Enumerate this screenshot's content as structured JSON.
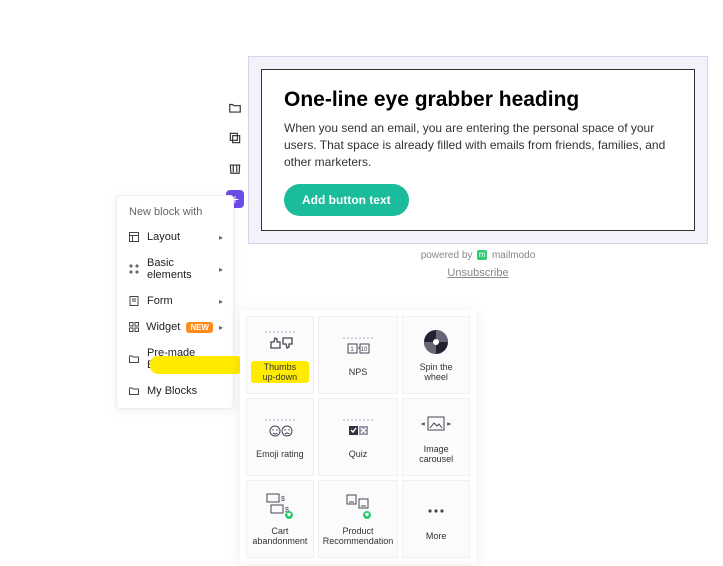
{
  "block": {
    "heading": "One-line eye grabber heading",
    "body": "When you send an email, you are entering the personal space of your users. That space is already filled with emails from friends, families, and other marketers.",
    "button": "Add button text"
  },
  "footer": {
    "powered_prefix": "powered by",
    "brand": "mailmodo",
    "unsubscribe": "Unsubscribe"
  },
  "menu": {
    "title": "New block with",
    "items": [
      {
        "label": "Layout",
        "has_sub": true
      },
      {
        "label": "Basic elements",
        "has_sub": true
      },
      {
        "label": "Form",
        "has_sub": true
      },
      {
        "label": "Widget",
        "badge": "NEW",
        "has_sub": true
      },
      {
        "label": "Pre-made Blocks",
        "has_sub": false
      },
      {
        "label": "My Blocks",
        "has_sub": false
      }
    ]
  },
  "widgets": [
    {
      "label": "Thumbs up-down",
      "icon": "thumbs",
      "highlighted": true
    },
    {
      "label": "NPS",
      "icon": "nps"
    },
    {
      "label": "Spin the wheel",
      "icon": "wheel"
    },
    {
      "label": "Emoji rating",
      "icon": "emoji"
    },
    {
      "label": "Quiz",
      "icon": "quiz"
    },
    {
      "label": "Image carousel",
      "icon": "carousel"
    },
    {
      "label": "Cart abandonment",
      "icon": "cart"
    },
    {
      "label": "Product Recommendation",
      "icon": "product"
    },
    {
      "label": "More",
      "icon": "more"
    }
  ]
}
